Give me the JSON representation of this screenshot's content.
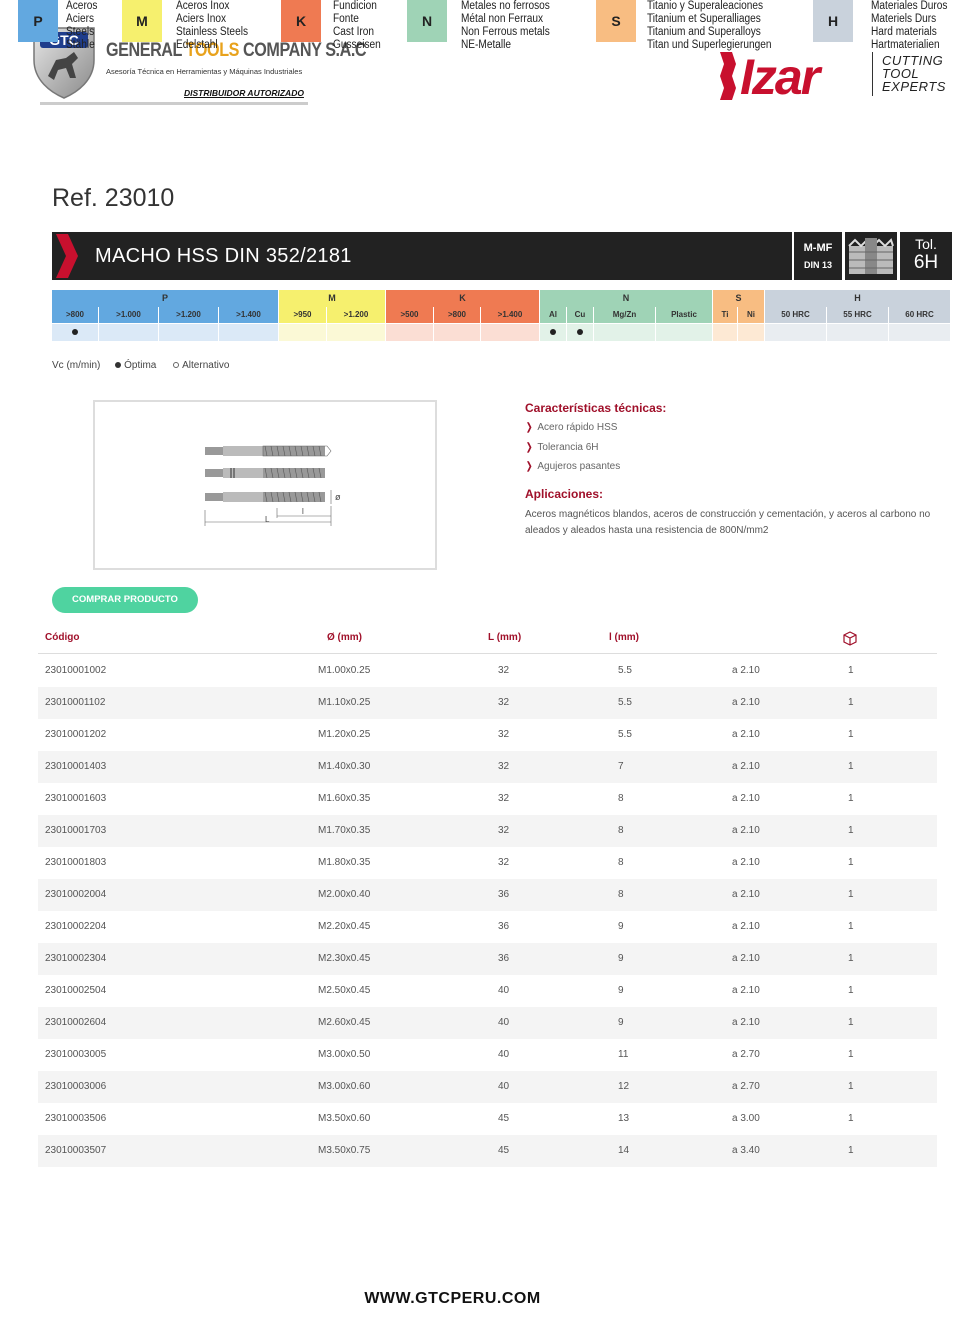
{
  "header": {
    "gtc_badge": "GTC",
    "company_part1": "GENERAL ",
    "company_part2": "TOOLS",
    "company_part3": " COMPANY S.A.C",
    "subtitle": "Asesoría Técnica en Herramientas y Máquinas Industriales",
    "distributor": "DISTRIBUIDOR AUTORIZADO",
    "brand_logo_text": "Izar",
    "brand_tagline": [
      "CUTTING",
      "TOOL",
      "EXPERTS"
    ]
  },
  "product": {
    "ref": "Ref. 23010",
    "title": "MACHO HSS DIN 352/2181",
    "standard_line1": "M-MF",
    "standard_line2": "DIN 13",
    "tol_label": "Tol.",
    "tol_value": "6H"
  },
  "materials": {
    "groups": [
      {
        "label": "P",
        "color": "#62a8e0"
      },
      {
        "label": "M",
        "color": "#f6f06e"
      },
      {
        "label": "K",
        "color": "#ef7a52"
      },
      {
        "label": "N",
        "color": "#9fd3b6"
      },
      {
        "label": "S",
        "color": "#f8bd82"
      },
      {
        "label": "H",
        "color": "#c9d2dc"
      }
    ],
    "sub": [
      ">800",
      ">1.000",
      ">1.200",
      ">1.400",
      ">950",
      ">1.200",
      ">500",
      ">800",
      ">1.400",
      "Al",
      "Cu",
      "Mg/Zn",
      "Plastic",
      "Ti",
      "Ni",
      "50 HRC",
      "55 HRC",
      "60 HRC"
    ],
    "optimal": [
      0,
      9,
      10
    ]
  },
  "legend": {
    "vc": "Vc (m/min)",
    "optimal": "Óptima",
    "alternative": "Alternativo"
  },
  "characteristics": {
    "title": "Características técnicas:",
    "items": [
      "Acero rápido HSS",
      "Tolerancia 6H",
      "Agujeros pasantes"
    ],
    "applications_title": "Aplicaciones:",
    "applications_text": "Aceros magnéticos blandos, aceros de construcción y cementación, y aceros al carbono no aleados y aleados hasta una resistencia de 800N/mm2"
  },
  "diagram": {
    "diameter_symbol": "ø",
    "L": "L",
    "l": "l"
  },
  "buy_button": "COMPRAR PRODUCTO",
  "table": {
    "headers": {
      "code": "Código",
      "diameter": "Ø (mm)",
      "L": "L (mm)",
      "l": "l (mm)",
      "pack_icon": "box-icon"
    },
    "rows": [
      [
        "23010001002",
        "M1.00x0.25",
        "32",
        "5.5",
        "a 2.10",
        "1"
      ],
      [
        "23010001102",
        "M1.10x0.25",
        "32",
        "5.5",
        "a 2.10",
        "1"
      ],
      [
        "23010001202",
        "M1.20x0.25",
        "32",
        "5.5",
        "a 2.10",
        "1"
      ],
      [
        "23010001403",
        "M1.40x0.30",
        "32",
        "7",
        "a 2.10",
        "1"
      ],
      [
        "23010001603",
        "M1.60x0.35",
        "32",
        "8",
        "a 2.10",
        "1"
      ],
      [
        "23010001703",
        "M1.70x0.35",
        "32",
        "8",
        "a 2.10",
        "1"
      ],
      [
        "23010001803",
        "M1.80x0.35",
        "32",
        "8",
        "a 2.10",
        "1"
      ],
      [
        "23010002004",
        "M2.00x0.40",
        "36",
        "8",
        "a 2.10",
        "1"
      ],
      [
        "23010002204",
        "M2.20x0.45",
        "36",
        "9",
        "a 2.10",
        "1"
      ],
      [
        "23010002304",
        "M2.30x0.45",
        "36",
        "9",
        "a 2.10",
        "1"
      ],
      [
        "23010002504",
        "M2.50x0.45",
        "40",
        "9",
        "a 2.10",
        "1"
      ],
      [
        "23010002604",
        "M2.60x0.45",
        "40",
        "9",
        "a 2.10",
        "1"
      ],
      [
        "23010003005",
        "M3.00x0.50",
        "40",
        "11",
        "a 2.70",
        "1"
      ],
      [
        "23010003006",
        "M3.00x0.60",
        "40",
        "12",
        "a 2.70",
        "1"
      ],
      [
        "23010003506",
        "M3.50x0.60",
        "45",
        "13",
        "a 3.00",
        "1"
      ],
      [
        "23010003507",
        "M3.50x0.75",
        "45",
        "14",
        "a 3.40",
        "1"
      ]
    ]
  },
  "footer": {
    "groups": [
      {
        "letter": "P",
        "color": "#62a8e0",
        "lines": [
          "Aceros",
          "Aciers",
          "Steels",
          "Stähle"
        ]
      },
      {
        "letter": "M",
        "color": "#f6f06e",
        "lines": [
          "Aceros Inox",
          "Aciers Inox",
          "Stainless Steels",
          "Edelstahl"
        ]
      },
      {
        "letter": "K",
        "color": "#ef7a52",
        "lines": [
          "Fundicion",
          "Fonte",
          "Cast Iron",
          "Gusseisen"
        ]
      },
      {
        "letter": "N",
        "color": "#9fd3b6",
        "lines": [
          "Metales no ferrosos",
          "Métal non Ferraux",
          "Non Ferrous metals",
          "NE-Metalle"
        ]
      },
      {
        "letter": "S",
        "color": "#f8bd82",
        "lines": [
          "Titanio y Superaleaciones",
          "Titanium et Superalliages",
          "Titanium and Superalloys",
          "Titan und Superlegierungen"
        ]
      },
      {
        "letter": "H",
        "color": "#c9d2dc",
        "lines": [
          "Materiales Duros",
          "Materiels Durs",
          "Hard materials",
          "Hartmaterialien"
        ]
      }
    ],
    "website": "WWW.GTCPERU.COM"
  },
  "colors": {
    "accent": "#a0102a",
    "button": "#4fd3a0",
    "title_bar": "#222222"
  }
}
